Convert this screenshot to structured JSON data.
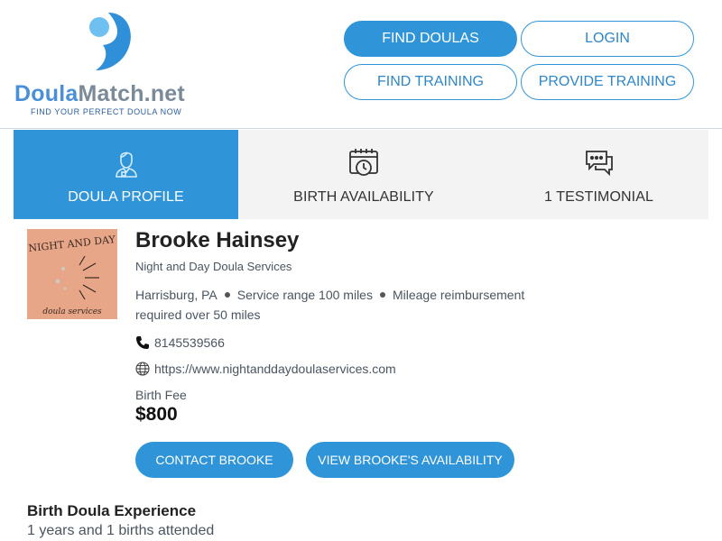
{
  "brand": {
    "name_part1": "Doula",
    "name_part2": "Match.net",
    "tagline": "FIND YOUR PERFECT DOULA NOW",
    "colors": {
      "primary": "#2f95d8",
      "logo_blue": "#4a90d9",
      "logo_gray": "#7a8a99"
    }
  },
  "nav": {
    "find_doulas": "FIND DOULAS",
    "login": "LOGIN",
    "find_training": "FIND TRAINING",
    "provide_training": "PROVIDE TRAINING"
  },
  "tabs": [
    {
      "label": "DOULA PROFILE",
      "icon": "person-icon",
      "active": true
    },
    {
      "label": "BIRTH AVAILABILITY",
      "icon": "calendar-clock-icon",
      "active": false
    },
    {
      "label": "1 TESTIMONIAL",
      "icon": "chat-bubbles-icon",
      "active": false
    }
  ],
  "profile": {
    "logo_text_top": "NIGHT AND DAY",
    "logo_text_bottom": "doula services",
    "name": "Brooke Hainsey",
    "business": "Night and Day Doula Services",
    "city": "Harrisburg, PA",
    "service_range": "Service range 100 miles",
    "mileage": "Mileage reimbursement required over 50 miles",
    "phone": "8145539566",
    "website": "https://www.nightanddaydoulaservices.com",
    "fee_label": "Birth Fee",
    "fee": "$800"
  },
  "actions": {
    "contact": "CONTACT BROOKE",
    "availability": "VIEW BROOKE'S AVAILABILITY"
  },
  "experience": {
    "title": "Birth Doula Experience",
    "text": "1 years and 1 births attended"
  }
}
